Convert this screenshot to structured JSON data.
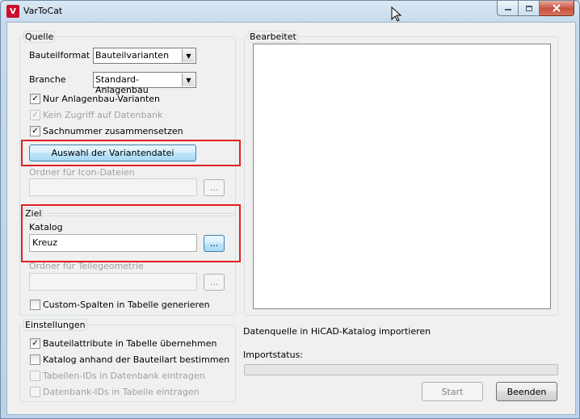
{
  "window": {
    "title": "VarToCat",
    "icon": "vartocat-app-icon",
    "icon_text": "V"
  },
  "icons": {
    "minimize": "minimize-icon",
    "maximize": "maximize-icon",
    "close": "close-icon",
    "cursor": "mouse-pointer-icon"
  },
  "quelle": {
    "label": "Quelle",
    "bauteilformat_label": "Bauteilformat",
    "bauteilformat_value": "Bauteilvarianten",
    "branche_label": "Branche",
    "branche_value": "Standard-Anlagenbau",
    "chk_anlagenbau": {
      "label": "Nur Anlagenbau-Varianten",
      "checked": true,
      "enabled": true
    },
    "chk_kein_zugriff": {
      "label": "Kein Zugriff auf Datenbank",
      "checked": true,
      "enabled": false
    },
    "chk_sachnummer": {
      "label": "Sachnummer zusammensetzen",
      "checked": true,
      "enabled": true
    },
    "auswahl_button": "Auswahl der Variantendatei",
    "icon_ordner_label": "Ordner für Icon-Dateien",
    "icon_ordner_value": "",
    "browse_label": "..."
  },
  "ziel": {
    "label": "Ziel",
    "katalog_label": "Katalog",
    "katalog_value": "Kreuz",
    "browse_label": "...",
    "teilegeometrie_label": "Ordner für Teilegeometrie",
    "teilegeometrie_value": "",
    "browse2_label": "...",
    "chk_custom": {
      "label": "Custom-Spalten in Tabelle generieren",
      "checked": false,
      "enabled": true
    }
  },
  "einstellungen": {
    "label": "Einstellungen",
    "chk_attribute": {
      "label": "Bauteilattribute in Tabelle übernehmen",
      "checked": true,
      "enabled": true
    },
    "chk_bauteilart": {
      "label": "Katalog anhand der Bauteilart bestimmen",
      "checked": false,
      "enabled": true
    },
    "chk_tabellen_ids": {
      "label": "Tabellen-IDs in Datenbank eintragen",
      "checked": false,
      "enabled": false
    },
    "chk_datenbank_ids": {
      "label": "Datenbank-IDs in Tabelle eintragen",
      "checked": false,
      "enabled": false
    }
  },
  "bearbeitet": {
    "label": "Bearbeitet"
  },
  "status": {
    "datenquelle_text": "Datenquelle in HiCAD-Katalog importieren",
    "importstatus_label": "Importstatus:",
    "progress": 0
  },
  "buttons": {
    "start": "Start",
    "beenden": "Beenden"
  },
  "checkmark": "✓",
  "colors": {
    "highlight": "#e02020",
    "client_bg": "#f0f0f0"
  }
}
